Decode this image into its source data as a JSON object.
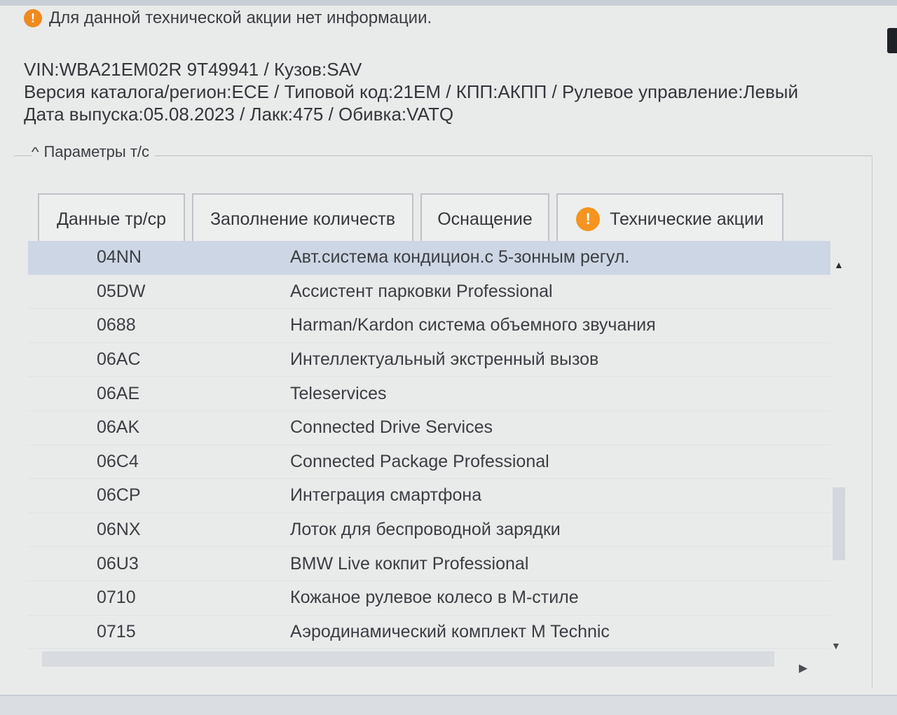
{
  "warning": {
    "icon": "warning-icon",
    "text": "Для данной технической акции нет информации."
  },
  "vehicle": {
    "line1": "VIN:WBA21EM02R 9T49941 / Кузов:SAV",
    "line2": "Версия каталога/регион:ECE / Типовой код:21EM / КПП:АКПП / Рулевое управление:Левый",
    "line3": "Дата выпуска:05.08.2023 / Лакк:475 / Обивка:VATQ"
  },
  "section": {
    "label": "Параметры т/с"
  },
  "tabs": [
    {
      "label": "Данные тр/ср"
    },
    {
      "label": "Заполнение количеств"
    },
    {
      "label": "Оснащение",
      "active": true
    },
    {
      "label": "Технические акции",
      "icon": "warning-icon"
    }
  ],
  "equipment": [
    {
      "code": "04NN",
      "desc": "Авт.система кондицион.с 5-зонным регул.",
      "selected": true
    },
    {
      "code": "05DW",
      "desc": "Ассистент парковки Professional"
    },
    {
      "code": "0688",
      "desc": "Harman/Kardon система объемного звучания"
    },
    {
      "code": "06AC",
      "desc": "Интеллектуальный экстренный вызов"
    },
    {
      "code": "06AE",
      "desc": "Teleservices"
    },
    {
      "code": "06AK",
      "desc": "Connected Drive Services"
    },
    {
      "code": "06C4",
      "desc": "Connected Package Professional"
    },
    {
      "code": "06CP",
      "desc": "Интеграция смартфона"
    },
    {
      "code": "06NX",
      "desc": "Лоток для беспроводной зарядки"
    },
    {
      "code": "06U3",
      "desc": "BMW Live кокпит Professional"
    },
    {
      "code": "0710",
      "desc": "Кожаное рулевое колесо в M-стиле"
    },
    {
      "code": "0715",
      "desc": "Аэродинамический комплект M Technic"
    }
  ],
  "colors": {
    "selection": "#cdd6e4",
    "warning": "#f59420"
  }
}
